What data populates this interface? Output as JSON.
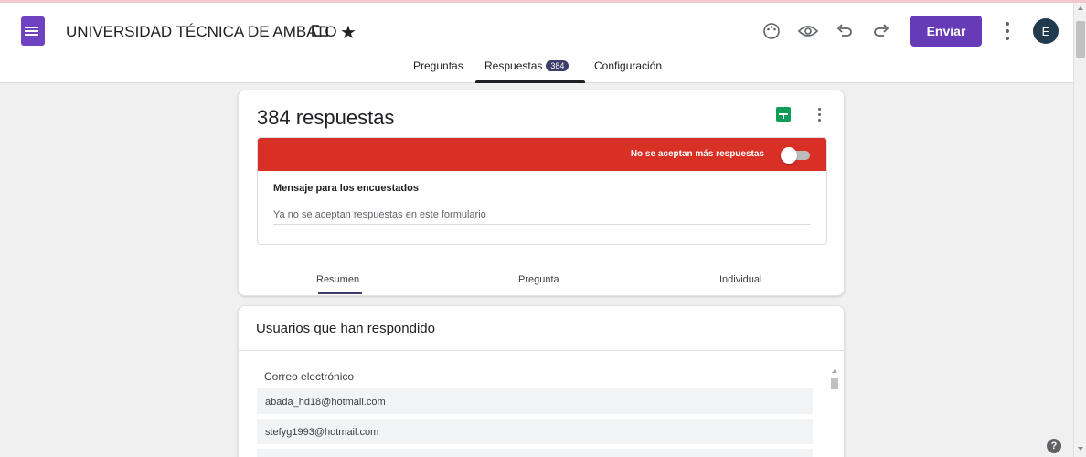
{
  "header": {
    "title": "UNIVERSIDAD TÉCNICA DE AMBATO",
    "send_label": "Enviar",
    "avatar_letter": "E",
    "icons": [
      "palette-icon",
      "preview-eye-icon",
      "undo-icon",
      "redo-icon",
      "more-vert-icon"
    ]
  },
  "tabs": {
    "questions": "Preguntas",
    "responses": "Respuestas",
    "responses_badge": "384",
    "settings": "Configuración"
  },
  "summary": {
    "count_title": "384 respuestas",
    "accepting_label": "No se aceptan más respuestas",
    "accepting_toggle_on": false,
    "message_label": "Mensaje para los encuestados",
    "message_value": "Ya no se aceptan respuestas en este formulario"
  },
  "view_tabs": {
    "summary": "Resumen",
    "question": "Pregunta",
    "individual": "Individual"
  },
  "respondents": {
    "title": "Usuarios que han respondido",
    "column_header": "Correo electrónico",
    "emails": [
      "abada_hd18@hotmail.com",
      "stefyg1993@hotmail.com"
    ]
  },
  "colors": {
    "accent": "#673ab7",
    "closed_banner": "#d93025",
    "sheets": "#0f9d58"
  }
}
